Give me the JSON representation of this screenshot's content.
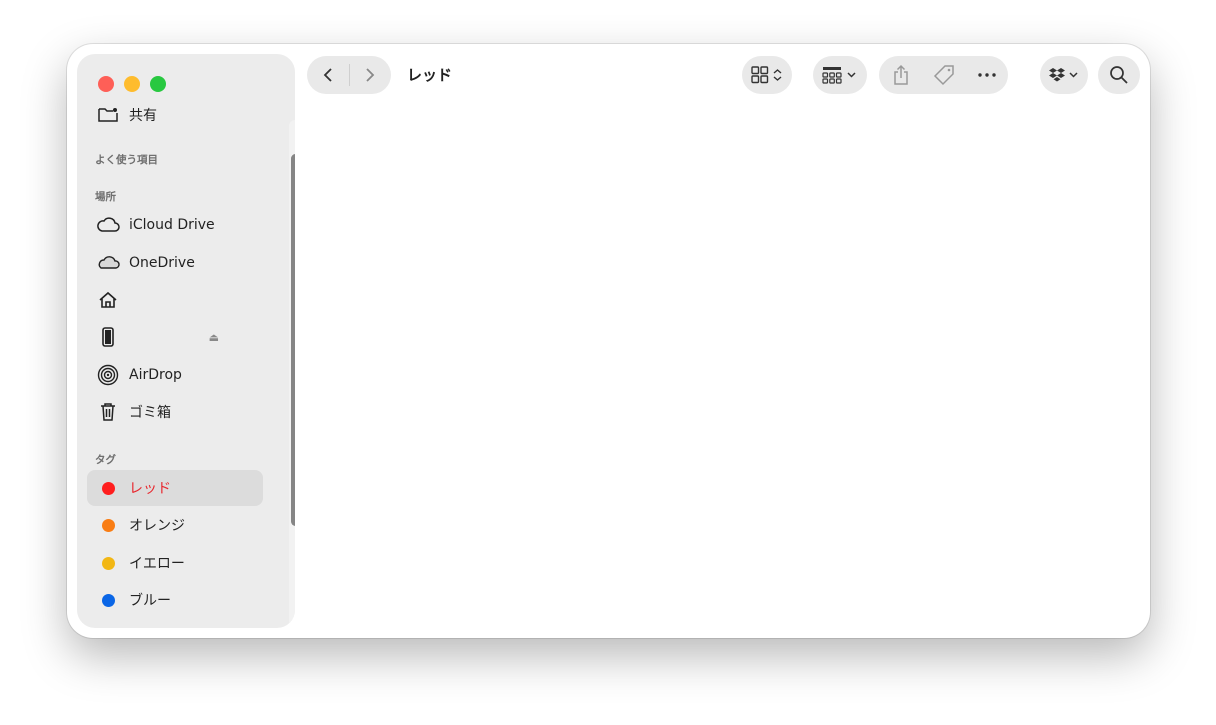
{
  "window": {
    "title": "レッド"
  },
  "sidebar": {
    "partial_item": {
      "label": "共有",
      "icon": "shared-folder-icon"
    },
    "favorites_header": "よく使う項目",
    "locations_header": "場所",
    "locations": [
      {
        "label": "iCloud Drive",
        "icon": "cloud-icon"
      },
      {
        "label": "OneDrive",
        "icon": "cloud-filled-icon"
      },
      {
        "label": "",
        "icon": "home-icon"
      },
      {
        "label": "",
        "icon": "iphone-icon",
        "eject": "⏏"
      },
      {
        "label": "AirDrop",
        "icon": "airdrop-icon"
      },
      {
        "label": "ゴミ箱",
        "icon": "trash-icon"
      }
    ],
    "tags_header": "タグ",
    "tags": [
      {
        "label": "レッド",
        "color": "#ff1e1e",
        "selected": true
      },
      {
        "label": "オレンジ",
        "color": "#f97d14"
      },
      {
        "label": "イエロー",
        "color": "#f2b714"
      },
      {
        "label": "ブルー",
        "color": "#0a66e6"
      }
    ]
  },
  "toolbar": {
    "back_icon": "chevron-left-icon",
    "forward_icon": "chevron-right-icon",
    "view_icon": "grid-view-icon",
    "group_icon": "group-by-icon",
    "share_icon": "share-icon",
    "tag_icon": "tag-icon",
    "more_icon": "ellipsis-icon",
    "dropbox_icon": "dropbox-icon",
    "search_icon": "search-icon"
  },
  "colors": {
    "accent_red": "#e8262d",
    "sidebar_bg": "#ececec",
    "pill_bg": "#e9e9e9"
  }
}
